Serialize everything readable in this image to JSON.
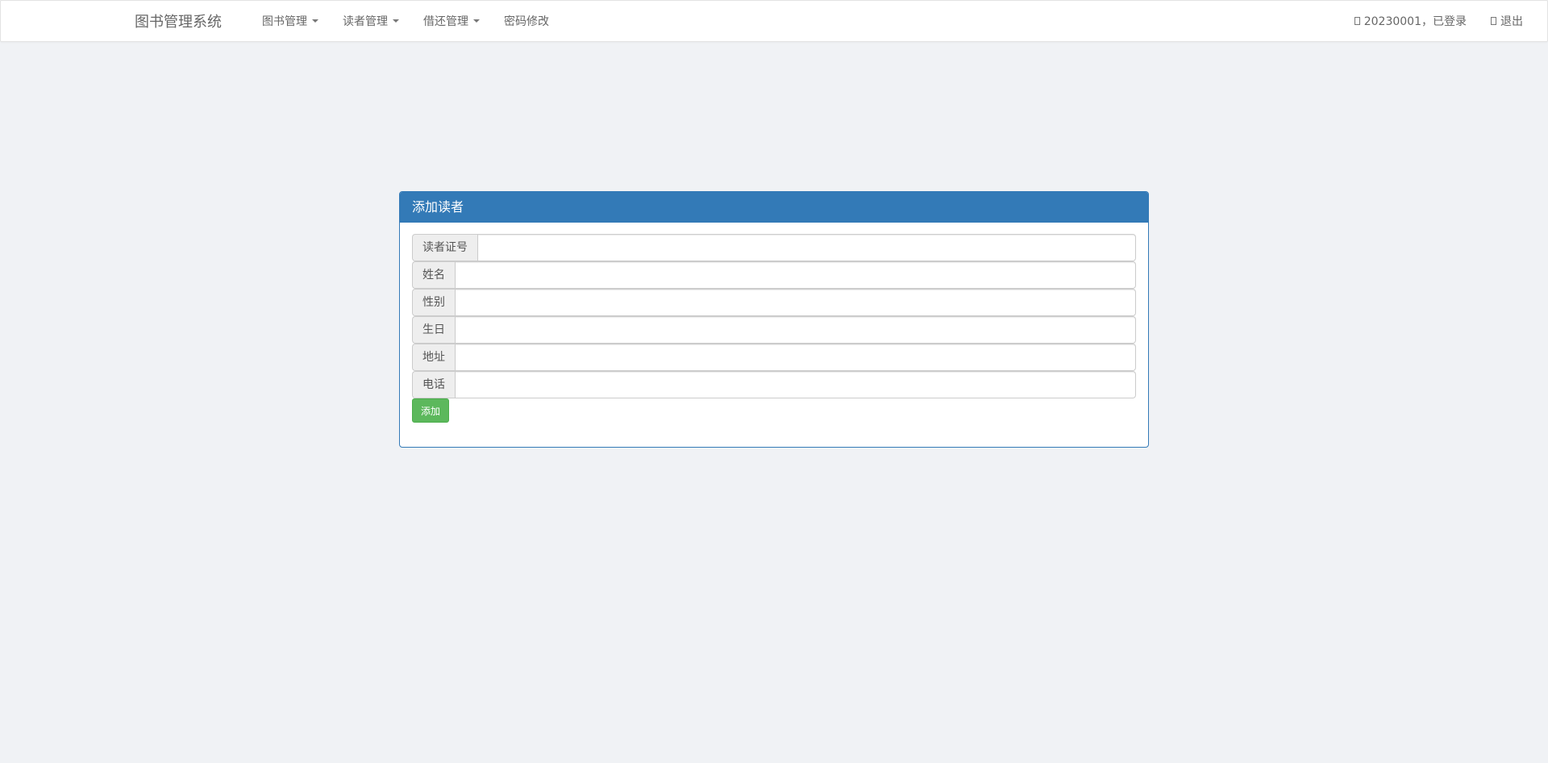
{
  "navbar": {
    "brand": "图书管理系统",
    "menu": [
      {
        "label": "图书管理",
        "dropdown": true
      },
      {
        "label": "读者管理",
        "dropdown": true
      },
      {
        "label": "借还管理",
        "dropdown": true
      },
      {
        "label": "密码修改",
        "dropdown": false
      }
    ],
    "user_status": "20230001，已登录",
    "logout": "退出"
  },
  "panel": {
    "title": "添加读者",
    "fields": [
      {
        "label": "读者证号",
        "value": ""
      },
      {
        "label": "姓名",
        "value": ""
      },
      {
        "label": "性别",
        "value": ""
      },
      {
        "label": "生日",
        "value": ""
      },
      {
        "label": "地址",
        "value": ""
      },
      {
        "label": "电话",
        "value": ""
      }
    ],
    "submit_label": "添加"
  },
  "colors": {
    "primary": "#337ab7",
    "success": "#5cb85c",
    "background": "#f0f2f5"
  }
}
